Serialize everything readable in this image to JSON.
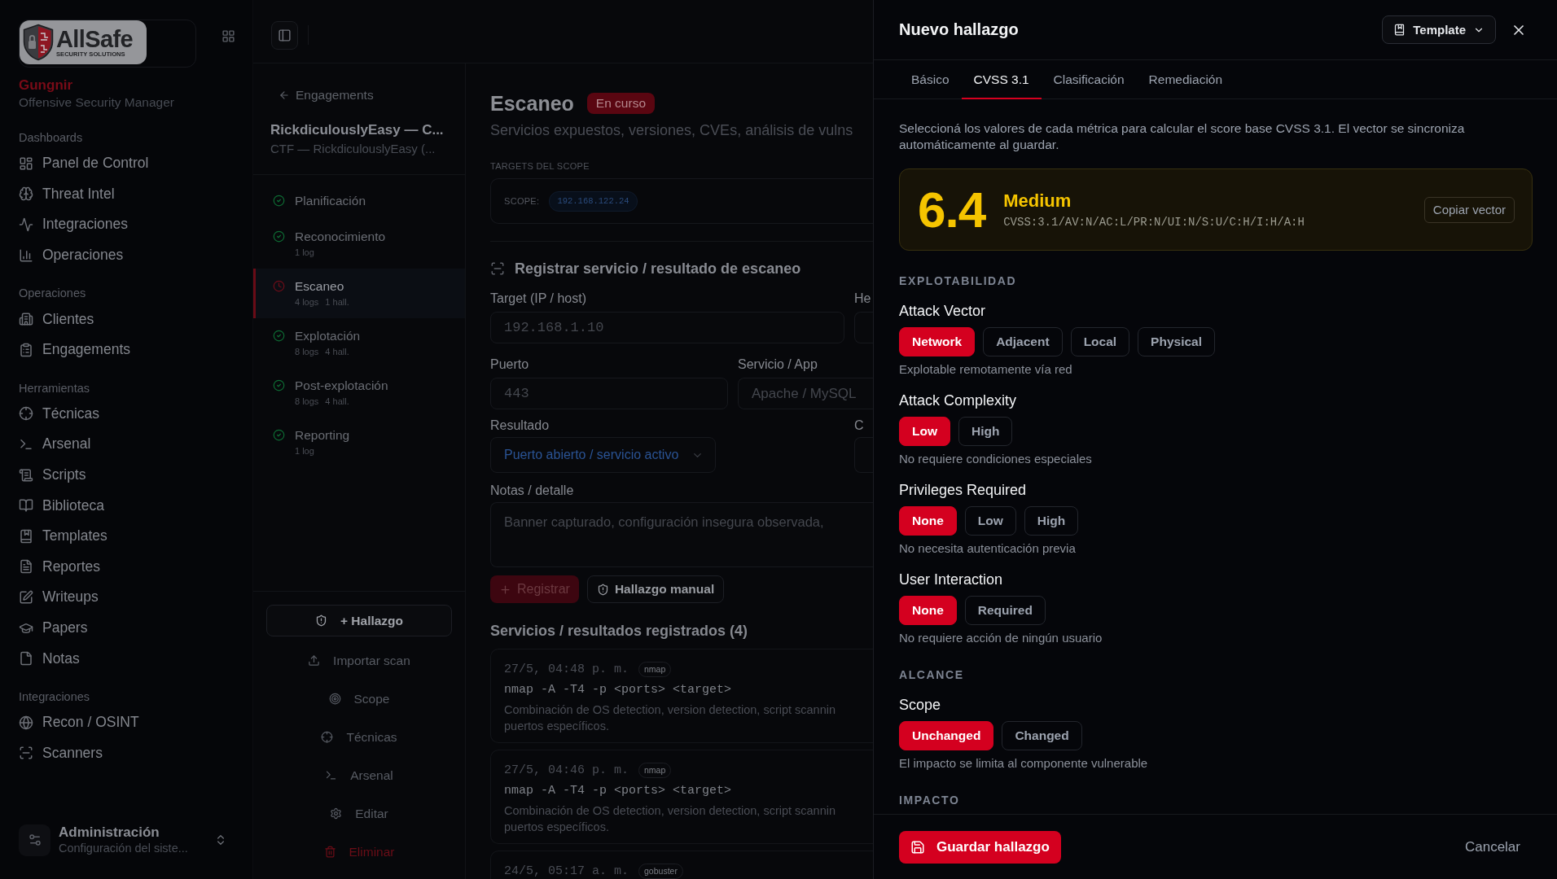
{
  "sidebar": {
    "logo": {
      "name": "AllSafe",
      "tagline": "SECURITY SOLUTIONS"
    },
    "app_name": "Gungnir",
    "app_subtitle": "Offensive Security Manager",
    "sections": [
      {
        "title": "Dashboards",
        "items": [
          "Panel de Control",
          "Threat Intel",
          "Integraciones",
          "Operaciones"
        ]
      },
      {
        "title": "Operaciones",
        "items": [
          "Clientes",
          "Engagements"
        ]
      },
      {
        "title": "Herramientas",
        "items": [
          "Técnicas",
          "Arsenal",
          "Scripts",
          "Biblioteca",
          "Templates",
          "Reportes",
          "Writeups",
          "Papers",
          "Notas"
        ]
      },
      {
        "title": "Integraciones",
        "items": [
          "Recon / OSINT",
          "Scanners"
        ]
      }
    ],
    "account": {
      "title": "Administración",
      "subtitle": "Configuración del siste..."
    }
  },
  "engagement": {
    "back_link": "Engagements",
    "title": "RickdiculouslyEasy — C...",
    "subtitle": "CTF — RickdiculouslyEasy (...",
    "phases": [
      {
        "name": "Planificación",
        "completed": true,
        "selected": false
      },
      {
        "name": "Reconocimiento",
        "completed": true,
        "selected": false,
        "meta": [
          "1 log"
        ]
      },
      {
        "name": "Escaneo",
        "completed": false,
        "selected": true,
        "meta": [
          "4 logs",
          "1 hall."
        ]
      },
      {
        "name": "Explotación",
        "completed": true,
        "selected": false,
        "meta": [
          "8 logs",
          "4 hall."
        ]
      },
      {
        "name": "Post-explotación",
        "completed": true,
        "selected": false,
        "meta": [
          "8 logs",
          "4 hall."
        ]
      },
      {
        "name": "Reporting",
        "completed": true,
        "selected": false,
        "meta": [
          "1 log"
        ]
      }
    ],
    "actions": [
      {
        "label": "+ Hallazgo",
        "kind": "outlined"
      },
      {
        "label": "Importar scan",
        "kind": "plain"
      },
      {
        "label": "Scope",
        "kind": "plain"
      },
      {
        "label": "Técnicas",
        "kind": "plain"
      },
      {
        "label": "Arsenal",
        "kind": "plain"
      },
      {
        "label": "Editar",
        "kind": "plain"
      },
      {
        "label": "Eliminar",
        "kind": "danger"
      }
    ]
  },
  "phase_view": {
    "title": "Escaneo",
    "status_badge": "En curso",
    "subtitle": "Servicios expuestos, versiones, CVEs, análisis de vulns",
    "scope": {
      "heading": "TARGETS DEL SCOPE",
      "label": "SCOPE:",
      "targets": [
        "192.168.122.24"
      ]
    },
    "form": {
      "title": "Registrar servicio / resultado de escaneo",
      "target": {
        "label": "Target (IP / host)",
        "placeholder": "192.168.1.10"
      },
      "field_2": {
        "label": "He"
      },
      "port": {
        "label": "Puerto",
        "placeholder": "443"
      },
      "service": {
        "label": "Servicio / App",
        "placeholder": "Apache / MySQL"
      },
      "result": {
        "label": "Resultado",
        "value": "Puerto abierto / servicio activo"
      },
      "field_6": {
        "label": "C"
      },
      "notes": {
        "label": "Notas / detalle",
        "placeholder": "Banner capturado, configuración insegura observada,"
      },
      "register_button": {
        "label": "Registrar",
        "disabled": true
      },
      "manual_button": {
        "label": "Hallazgo manual"
      }
    },
    "records": {
      "title": "Servicios / resultados registrados (4)",
      "items": [
        {
          "time": "27/5, 04:48 p. m.",
          "tool": "nmap",
          "command": "nmap -A -T4 -p <ports> <target>",
          "description_lines": [
            "Combinación de OS detection, version detection, script scannin",
            "puertos específicos."
          ]
        },
        {
          "time": "27/5, 04:46 p. m.",
          "tool": "nmap",
          "command": "nmap -A -T4 -p <ports> <target>",
          "description_lines": [
            "Combinación de OS detection, version detection, script scannin",
            "puertos específicos."
          ]
        },
        {
          "time": "24/5, 05:17 a. m.",
          "tool": "gobuster"
        }
      ]
    }
  },
  "drawer": {
    "title": "Nuevo hallazgo",
    "template_button": "Template",
    "tabs": [
      {
        "label": "Básico",
        "selected": false
      },
      {
        "label": "CVSS 3.1",
        "selected": true
      },
      {
        "label": "Clasificación",
        "selected": false
      },
      {
        "label": "Remediación",
        "selected": false
      }
    ],
    "intro": "Seleccioná los valores de cada métrica para calcular el score base CVSS 3.1. El vector se sincroniza automáticamente al guardar.",
    "score": {
      "value": "6.4",
      "severity": "Medium",
      "vector": "CVSS:3.1/AV:N/AC:L/PR:N/UI:N/S:U/C:H/I:H/A:H",
      "copy_button": "Copiar vector"
    },
    "sections": [
      {
        "title": "EXPLOTABILIDAD",
        "metrics": [
          {
            "label": "Attack Vector",
            "options": [
              {
                "label": "Network",
                "selected": true
              },
              {
                "label": "Adjacent",
                "selected": false
              },
              {
                "label": "Local",
                "selected": false
              },
              {
                "label": "Physical",
                "selected": false
              }
            ],
            "hint": "Explotable remotamente vía red"
          },
          {
            "label": "Attack Complexity",
            "options": [
              {
                "label": "Low",
                "selected": true
              },
              {
                "label": "High",
                "selected": false
              }
            ],
            "hint": "No requiere condiciones especiales"
          },
          {
            "label": "Privileges Required",
            "options": [
              {
                "label": "None",
                "selected": true
              },
              {
                "label": "Low",
                "selected": false
              },
              {
                "label": "High",
                "selected": false
              }
            ],
            "hint": "No necesita autenticación previa"
          },
          {
            "label": "User Interaction",
            "options": [
              {
                "label": "None",
                "selected": true
              },
              {
                "label": "Required",
                "selected": false
              }
            ],
            "hint": "No requiere acción de ningún usuario"
          }
        ]
      },
      {
        "title": "ALCANCE",
        "metrics": [
          {
            "label": "Scope",
            "options": [
              {
                "label": "Unchanged",
                "selected": true
              },
              {
                "label": "Changed",
                "selected": false
              }
            ],
            "hint": "El impacto se limita al componente vulnerable"
          }
        ]
      },
      {
        "title": "IMPACTO"
      }
    ],
    "footer": {
      "save_button": "Guardar hallazgo",
      "cancel_button": "Cancelar"
    }
  }
}
